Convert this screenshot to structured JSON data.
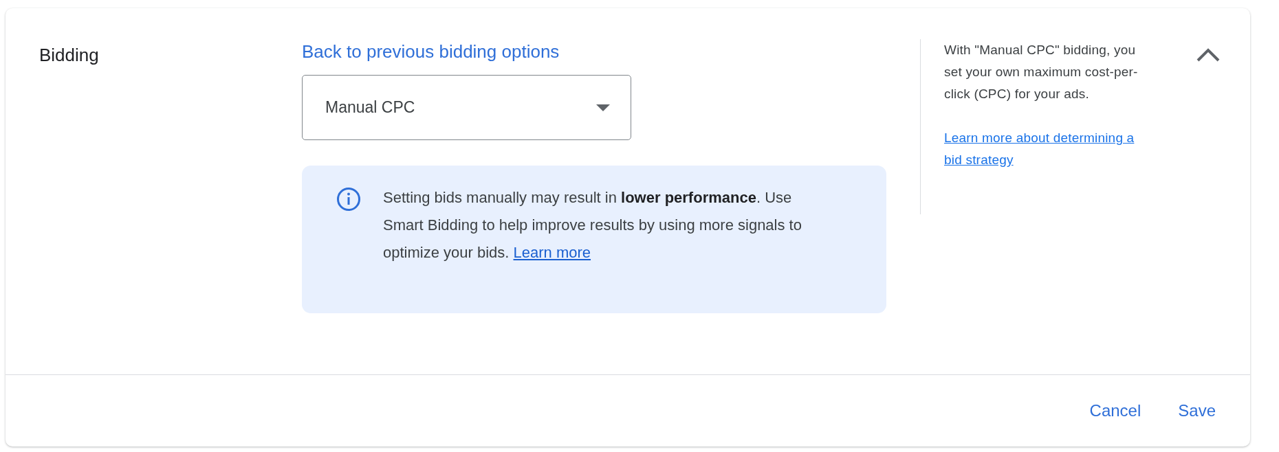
{
  "section": {
    "title": "Bidding",
    "expanded": true
  },
  "back_link": "Back to previous bidding options",
  "strategy_dropdown": {
    "value": "Manual CPC"
  },
  "notice": {
    "text": "Setting bids manually may result in **lower performance**. Use Smart Bidding to help improve results by using more signals to optimize your bids.",
    "link": "Learn more"
  },
  "help": {
    "text": "With \"Manual CPC\" bidding, you set your own maximum cost-per-click (CPC) for your ads.",
    "link": "Learn more about determining a bid strategy"
  },
  "buttons": [
    {
      "label": "Cancel"
    },
    {
      "label": "Save"
    }
  ]
}
